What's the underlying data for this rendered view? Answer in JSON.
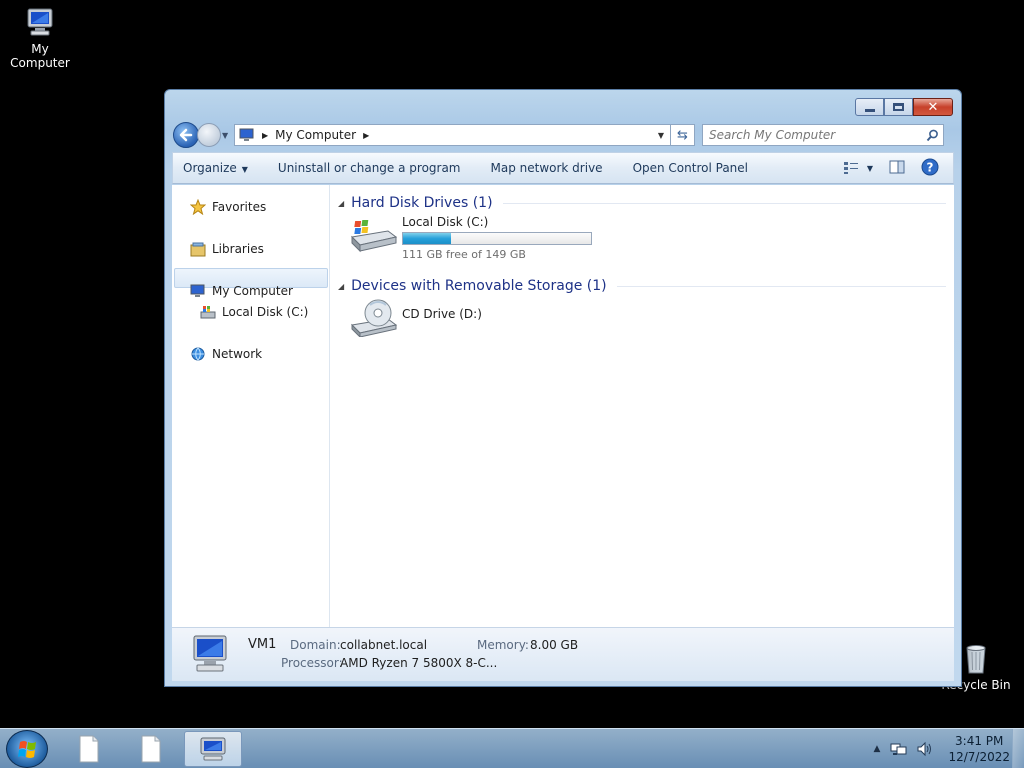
{
  "desktop": {
    "icons": [
      {
        "label": "My Computer",
        "icon": "computer-icon"
      },
      {
        "label": "Recycle Bin",
        "icon": "recycle-bin-icon"
      }
    ]
  },
  "window": {
    "address": {
      "path": [
        "My Computer"
      ],
      "icon": "computer-icon"
    },
    "search": {
      "placeholder": "Search My Computer"
    },
    "commands": {
      "organize": "Organize",
      "uninstall": "Uninstall or change a program",
      "map_drive": "Map network drive",
      "control_panel": "Open Control Panel"
    },
    "navpane": {
      "favorites": "Favorites",
      "libraries": "Libraries",
      "my_computer": "My Computer",
      "local_disk": "Local Disk (C:)",
      "network": "Network"
    },
    "groups": {
      "hdd": {
        "header": "Hard Disk Drives (1)",
        "items": [
          {
            "name": "Local Disk (C:)",
            "free_text": "111 GB free of 149 GB",
            "used_fraction": 0.255
          }
        ]
      },
      "removable": {
        "header": "Devices with Removable Storage (1)",
        "items": [
          {
            "name": "CD Drive (D:)"
          }
        ]
      }
    },
    "details": {
      "computer_name": "VM1",
      "domain_label": "Domain:",
      "domain_value": "collabnet.local",
      "memory_label": "Memory:",
      "memory_value": "8.00 GB",
      "processor_label": "Processor:",
      "processor_value": "AMD Ryzen 7 5800X 8-C..."
    }
  },
  "taskbar": {
    "clock": {
      "time": "3:41 PM",
      "date": "12/7/2022"
    }
  },
  "colors": {
    "accent": "#1e3287",
    "progress": "#26a0da",
    "command_text": "#1e395b"
  }
}
